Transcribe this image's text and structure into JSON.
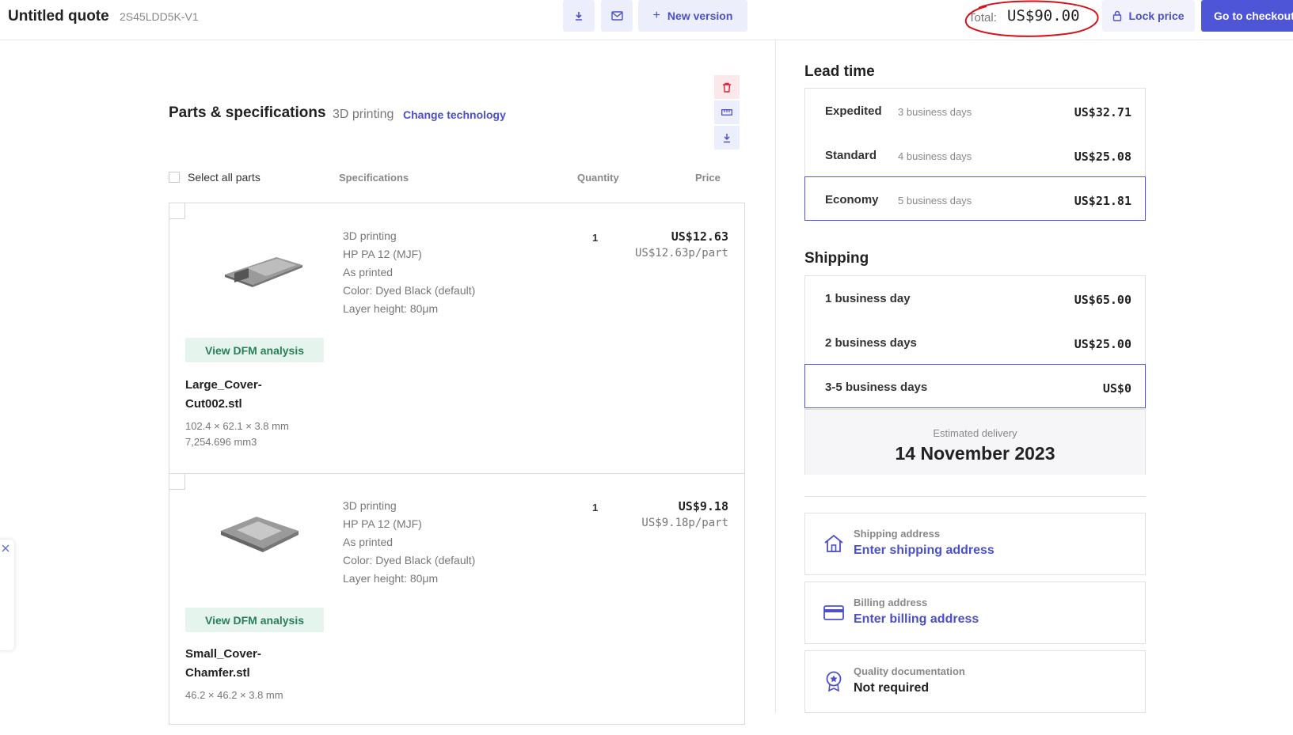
{
  "header": {
    "title": "Untitled quote",
    "quote_id": "2S45LDD5K-V1",
    "new_version_label": "New version",
    "total_label": "Total:",
    "total_value": "US$90.00",
    "lock_price_label": "Lock price",
    "checkout_label": "Go to checkout"
  },
  "parts": {
    "title": "Parts & specifications",
    "technology": "3D printing",
    "change_technology": "Change technology",
    "select_all": "Select all parts",
    "col_specifications": "Specifications",
    "col_quantity": "Quantity",
    "col_price": "Price",
    "dfm_label": "View DFM analysis",
    "items": [
      {
        "name": "Large_Cover-Cut002.stl",
        "dims": "102.4 × 62.1 × 3.8 mm",
        "volume": "7,254.696 mm3",
        "specs": [
          "3D printing",
          "HP PA 12 (MJF)",
          "As printed",
          "Color: Dyed Black (default)",
          "Layer height: 80μm"
        ],
        "quantity": "1",
        "price": "US$12.63",
        "unit_price": "US$12.63p/part"
      },
      {
        "name": "Small_Cover-Chamfer.stl",
        "dims": "46.2 × 46.2 × 3.8 mm",
        "specs": [
          "3D printing",
          "HP PA 12 (MJF)",
          "As printed",
          "Color: Dyed Black (default)",
          "Layer height: 80μm"
        ],
        "quantity": "1",
        "price": "US$9.18",
        "unit_price": "US$9.18p/part"
      }
    ]
  },
  "lead_time": {
    "title": "Lead time",
    "options": [
      {
        "name": "Expedited",
        "days": "3 business days",
        "price": "US$32.71"
      },
      {
        "name": "Standard",
        "days": "4 business days",
        "price": "US$25.08"
      },
      {
        "name": "Economy",
        "days": "5 business days",
        "price": "US$21.81"
      }
    ],
    "selected": "Economy"
  },
  "shipping": {
    "title": "Shipping",
    "options": [
      {
        "name": "1 business day",
        "price": "US$65.00"
      },
      {
        "name": "2 business days",
        "price": "US$25.00"
      },
      {
        "name": "3-5 business days",
        "price": "US$0"
      }
    ],
    "selected": "3-5 business days",
    "estimated_label": "Estimated delivery",
    "estimated_date": "14 November 2023"
  },
  "addresses": {
    "shipping_label": "Shipping address",
    "shipping_link": "Enter shipping address",
    "billing_label": "Billing address",
    "billing_link": "Enter billing address",
    "quality_label": "Quality documentation",
    "quality_value": "Not required"
  },
  "colors": {
    "accent": "#4e55d6",
    "link": "#4b50c9",
    "dfm_bg": "#e5f4ed",
    "dfm_text": "#2a7f5a",
    "annotation": "#d8101a"
  },
  "icons": [
    "download-icon",
    "mail-icon",
    "plus-icon",
    "lock-icon",
    "trash-icon",
    "ruler-icon",
    "home-icon",
    "credit-card-icon",
    "award-icon",
    "close-icon"
  ]
}
